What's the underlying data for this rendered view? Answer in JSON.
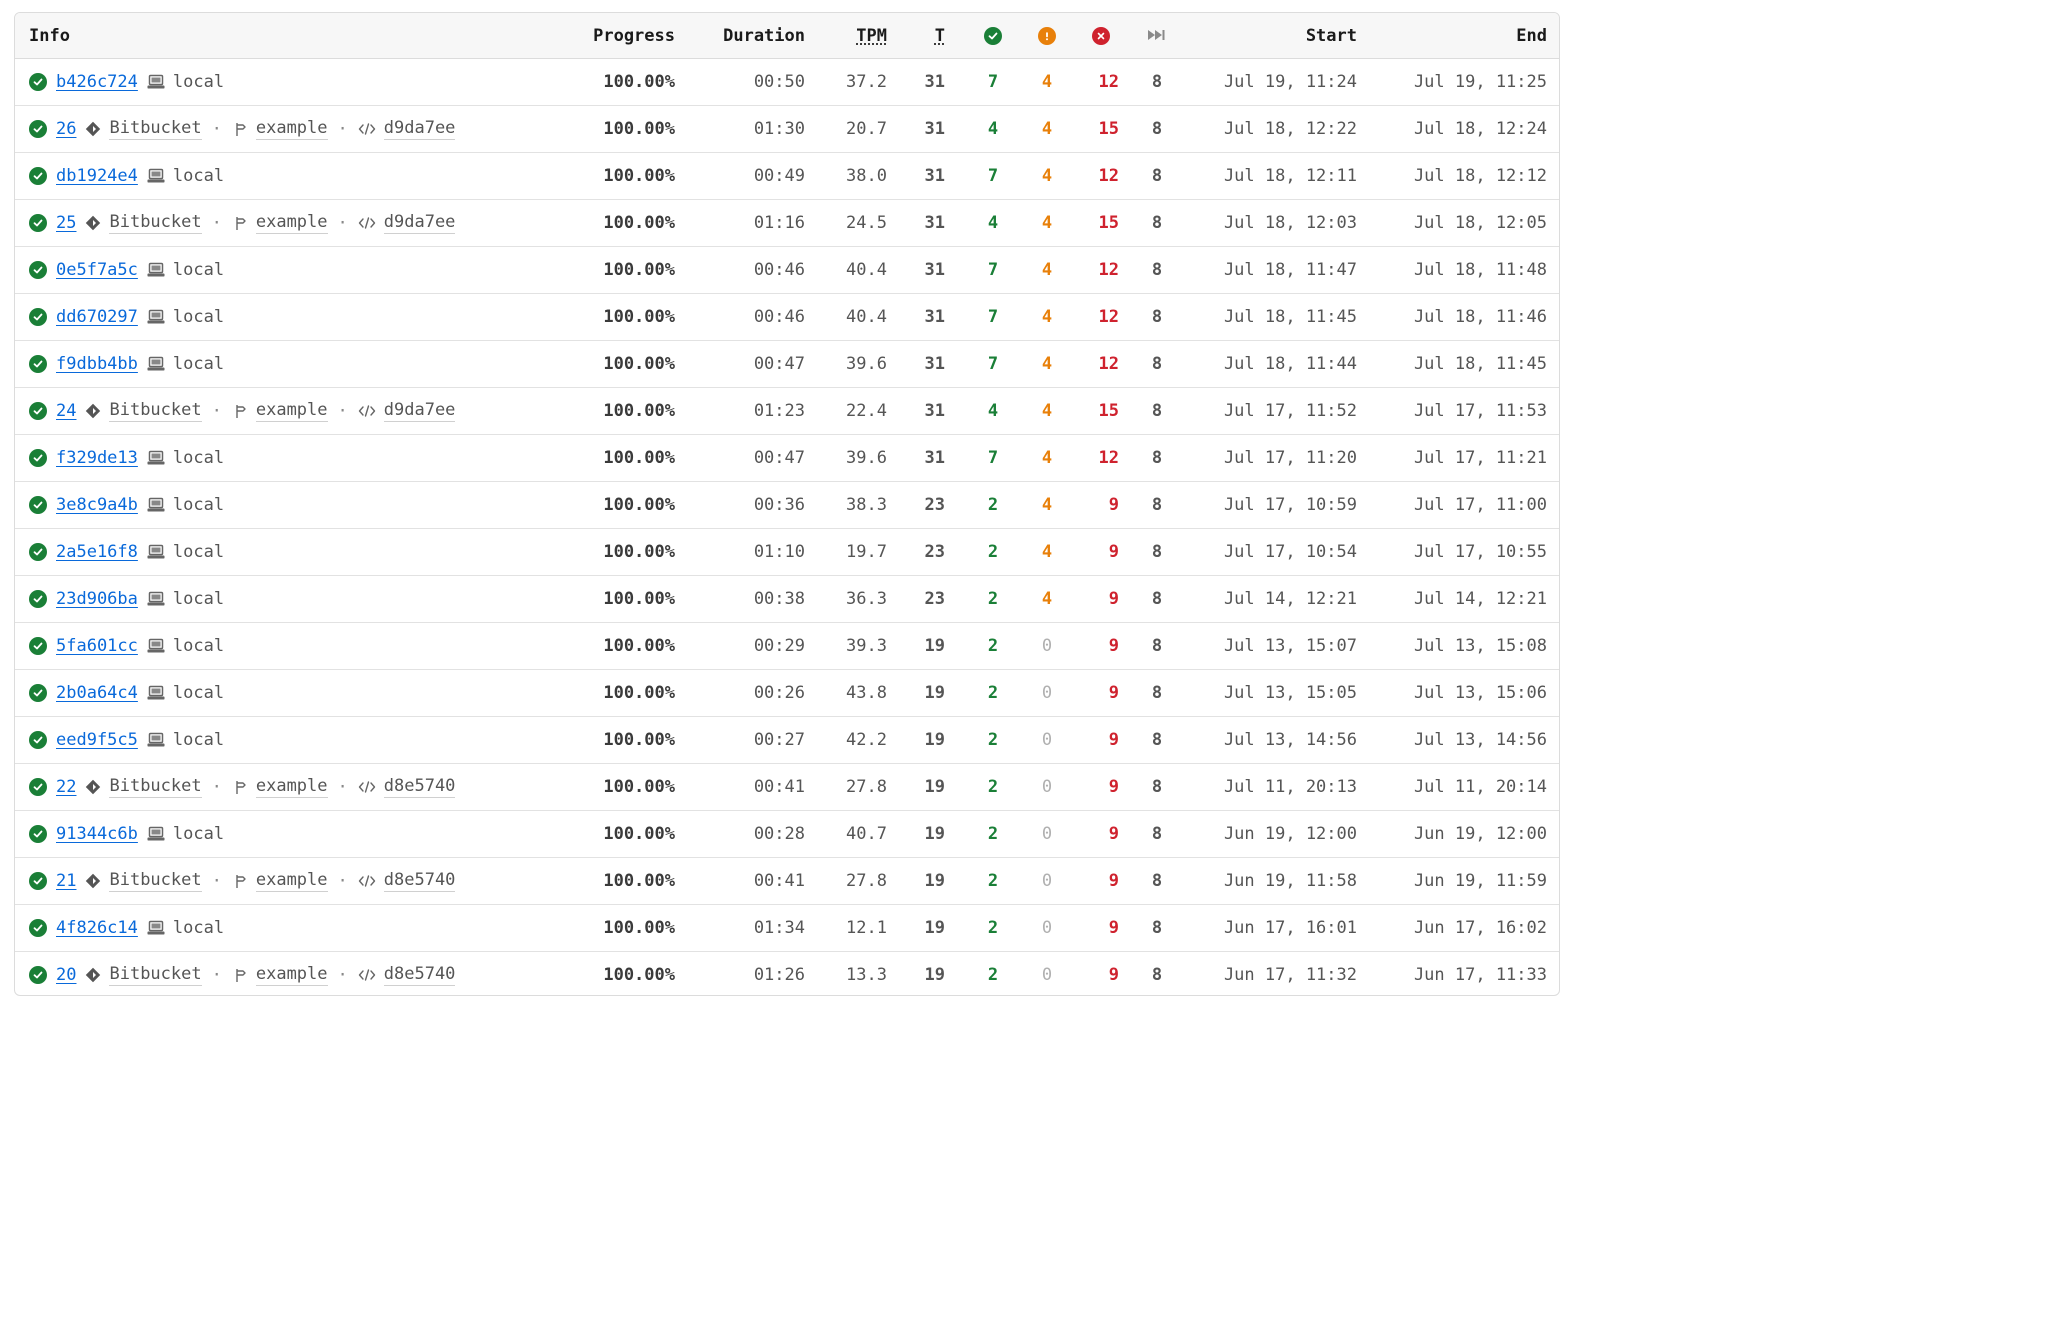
{
  "headers": {
    "info": "Info",
    "progress": "Progress",
    "duration": "Duration",
    "tpm": "TPM",
    "t": "T",
    "start": "Start",
    "end": "End"
  },
  "header_icons": {
    "passed": "check-circle-icon",
    "warnings": "exclamation-circle-icon",
    "failed": "x-circle-icon",
    "skipped": "fast-forward-icon"
  },
  "colors": {
    "passed": "#1a7f37",
    "warnings": "#e8800a",
    "failed": "#cf222e",
    "link": "#0969da"
  },
  "rows": [
    {
      "id": "b426c724",
      "kind": "local",
      "source": "local",
      "progress": "100.00%",
      "duration": "00:50",
      "tpm": "37.2",
      "t": "31",
      "passed": "7",
      "warnings": "4",
      "failed": "12",
      "skipped": "8",
      "start": "Jul 19, 11:24",
      "end": "Jul 19, 11:25"
    },
    {
      "id": "26",
      "kind": "ci",
      "source": "Bitbucket",
      "branch": "example",
      "commit": "d9da7ee",
      "progress": "100.00%",
      "duration": "01:30",
      "tpm": "20.7",
      "t": "31",
      "passed": "4",
      "warnings": "4",
      "failed": "15",
      "skipped": "8",
      "start": "Jul 18, 12:22",
      "end": "Jul 18, 12:24"
    },
    {
      "id": "db1924e4",
      "kind": "local",
      "source": "local",
      "progress": "100.00%",
      "duration": "00:49",
      "tpm": "38.0",
      "t": "31",
      "passed": "7",
      "warnings": "4",
      "failed": "12",
      "skipped": "8",
      "start": "Jul 18, 12:11",
      "end": "Jul 18, 12:12"
    },
    {
      "id": "25",
      "kind": "ci",
      "source": "Bitbucket",
      "branch": "example",
      "commit": "d9da7ee",
      "progress": "100.00%",
      "duration": "01:16",
      "tpm": "24.5",
      "t": "31",
      "passed": "4",
      "warnings": "4",
      "failed": "15",
      "skipped": "8",
      "start": "Jul 18, 12:03",
      "end": "Jul 18, 12:05"
    },
    {
      "id": "0e5f7a5c",
      "kind": "local",
      "source": "local",
      "progress": "100.00%",
      "duration": "00:46",
      "tpm": "40.4",
      "t": "31",
      "passed": "7",
      "warnings": "4",
      "failed": "12",
      "skipped": "8",
      "start": "Jul 18, 11:47",
      "end": "Jul 18, 11:48"
    },
    {
      "id": "dd670297",
      "kind": "local",
      "source": "local",
      "progress": "100.00%",
      "duration": "00:46",
      "tpm": "40.4",
      "t": "31",
      "passed": "7",
      "warnings": "4",
      "failed": "12",
      "skipped": "8",
      "start": "Jul 18, 11:45",
      "end": "Jul 18, 11:46"
    },
    {
      "id": "f9dbb4bb",
      "kind": "local",
      "source": "local",
      "progress": "100.00%",
      "duration": "00:47",
      "tpm": "39.6",
      "t": "31",
      "passed": "7",
      "warnings": "4",
      "failed": "12",
      "skipped": "8",
      "start": "Jul 18, 11:44",
      "end": "Jul 18, 11:45"
    },
    {
      "id": "24",
      "kind": "ci",
      "source": "Bitbucket",
      "branch": "example",
      "commit": "d9da7ee",
      "progress": "100.00%",
      "duration": "01:23",
      "tpm": "22.4",
      "t": "31",
      "passed": "4",
      "warnings": "4",
      "failed": "15",
      "skipped": "8",
      "start": "Jul 17, 11:52",
      "end": "Jul 17, 11:53"
    },
    {
      "id": "f329de13",
      "kind": "local",
      "source": "local",
      "progress": "100.00%",
      "duration": "00:47",
      "tpm": "39.6",
      "t": "31",
      "passed": "7",
      "warnings": "4",
      "failed": "12",
      "skipped": "8",
      "start": "Jul 17, 11:20",
      "end": "Jul 17, 11:21"
    },
    {
      "id": "3e8c9a4b",
      "kind": "local",
      "source": "local",
      "progress": "100.00%",
      "duration": "00:36",
      "tpm": "38.3",
      "t": "23",
      "passed": "2",
      "warnings": "4",
      "failed": "9",
      "skipped": "8",
      "start": "Jul 17, 10:59",
      "end": "Jul 17, 11:00"
    },
    {
      "id": "2a5e16f8",
      "kind": "local",
      "source": "local",
      "progress": "100.00%",
      "duration": "01:10",
      "tpm": "19.7",
      "t": "23",
      "passed": "2",
      "warnings": "4",
      "failed": "9",
      "skipped": "8",
      "start": "Jul 17, 10:54",
      "end": "Jul 17, 10:55"
    },
    {
      "id": "23d906ba",
      "kind": "local",
      "source": "local",
      "progress": "100.00%",
      "duration": "00:38",
      "tpm": "36.3",
      "t": "23",
      "passed": "2",
      "warnings": "4",
      "failed": "9",
      "skipped": "8",
      "start": "Jul 14, 12:21",
      "end": "Jul 14, 12:21"
    },
    {
      "id": "5fa601cc",
      "kind": "local",
      "source": "local",
      "progress": "100.00%",
      "duration": "00:29",
      "tpm": "39.3",
      "t": "19",
      "passed": "2",
      "warnings": "0",
      "failed": "9",
      "skipped": "8",
      "start": "Jul 13, 15:07",
      "end": "Jul 13, 15:08"
    },
    {
      "id": "2b0a64c4",
      "kind": "local",
      "source": "local",
      "progress": "100.00%",
      "duration": "00:26",
      "tpm": "43.8",
      "t": "19",
      "passed": "2",
      "warnings": "0",
      "failed": "9",
      "skipped": "8",
      "start": "Jul 13, 15:05",
      "end": "Jul 13, 15:06"
    },
    {
      "id": "eed9f5c5",
      "kind": "local",
      "source": "local",
      "progress": "100.00%",
      "duration": "00:27",
      "tpm": "42.2",
      "t": "19",
      "passed": "2",
      "warnings": "0",
      "failed": "9",
      "skipped": "8",
      "start": "Jul 13, 14:56",
      "end": "Jul 13, 14:56"
    },
    {
      "id": "22",
      "kind": "ci",
      "source": "Bitbucket",
      "branch": "example",
      "commit": "d8e5740",
      "progress": "100.00%",
      "duration": "00:41",
      "tpm": "27.8",
      "t": "19",
      "passed": "2",
      "warnings": "0",
      "failed": "9",
      "skipped": "8",
      "start": "Jul 11, 20:13",
      "end": "Jul 11, 20:14"
    },
    {
      "id": "91344c6b",
      "kind": "local",
      "source": "local",
      "progress": "100.00%",
      "duration": "00:28",
      "tpm": "40.7",
      "t": "19",
      "passed": "2",
      "warnings": "0",
      "failed": "9",
      "skipped": "8",
      "start": "Jun 19, 12:00",
      "end": "Jun 19, 12:00"
    },
    {
      "id": "21",
      "kind": "ci",
      "source": "Bitbucket",
      "branch": "example",
      "commit": "d8e5740",
      "progress": "100.00%",
      "duration": "00:41",
      "tpm": "27.8",
      "t": "19",
      "passed": "2",
      "warnings": "0",
      "failed": "9",
      "skipped": "8",
      "start": "Jun 19, 11:58",
      "end": "Jun 19, 11:59"
    },
    {
      "id": "4f826c14",
      "kind": "local",
      "source": "local",
      "progress": "100.00%",
      "duration": "01:34",
      "tpm": "12.1",
      "t": "19",
      "passed": "2",
      "warnings": "0",
      "failed": "9",
      "skipped": "8",
      "start": "Jun 17, 16:01",
      "end": "Jun 17, 16:02"
    },
    {
      "id": "20",
      "kind": "ci",
      "source": "Bitbucket",
      "branch": "example",
      "commit": "d8e5740",
      "progress": "100.00%",
      "duration": "01:26",
      "tpm": "13.3",
      "t": "19",
      "passed": "2",
      "warnings": "0",
      "failed": "9",
      "skipped": "8",
      "start": "Jun 17, 11:32",
      "end": "Jun 17, 11:33"
    }
  ]
}
